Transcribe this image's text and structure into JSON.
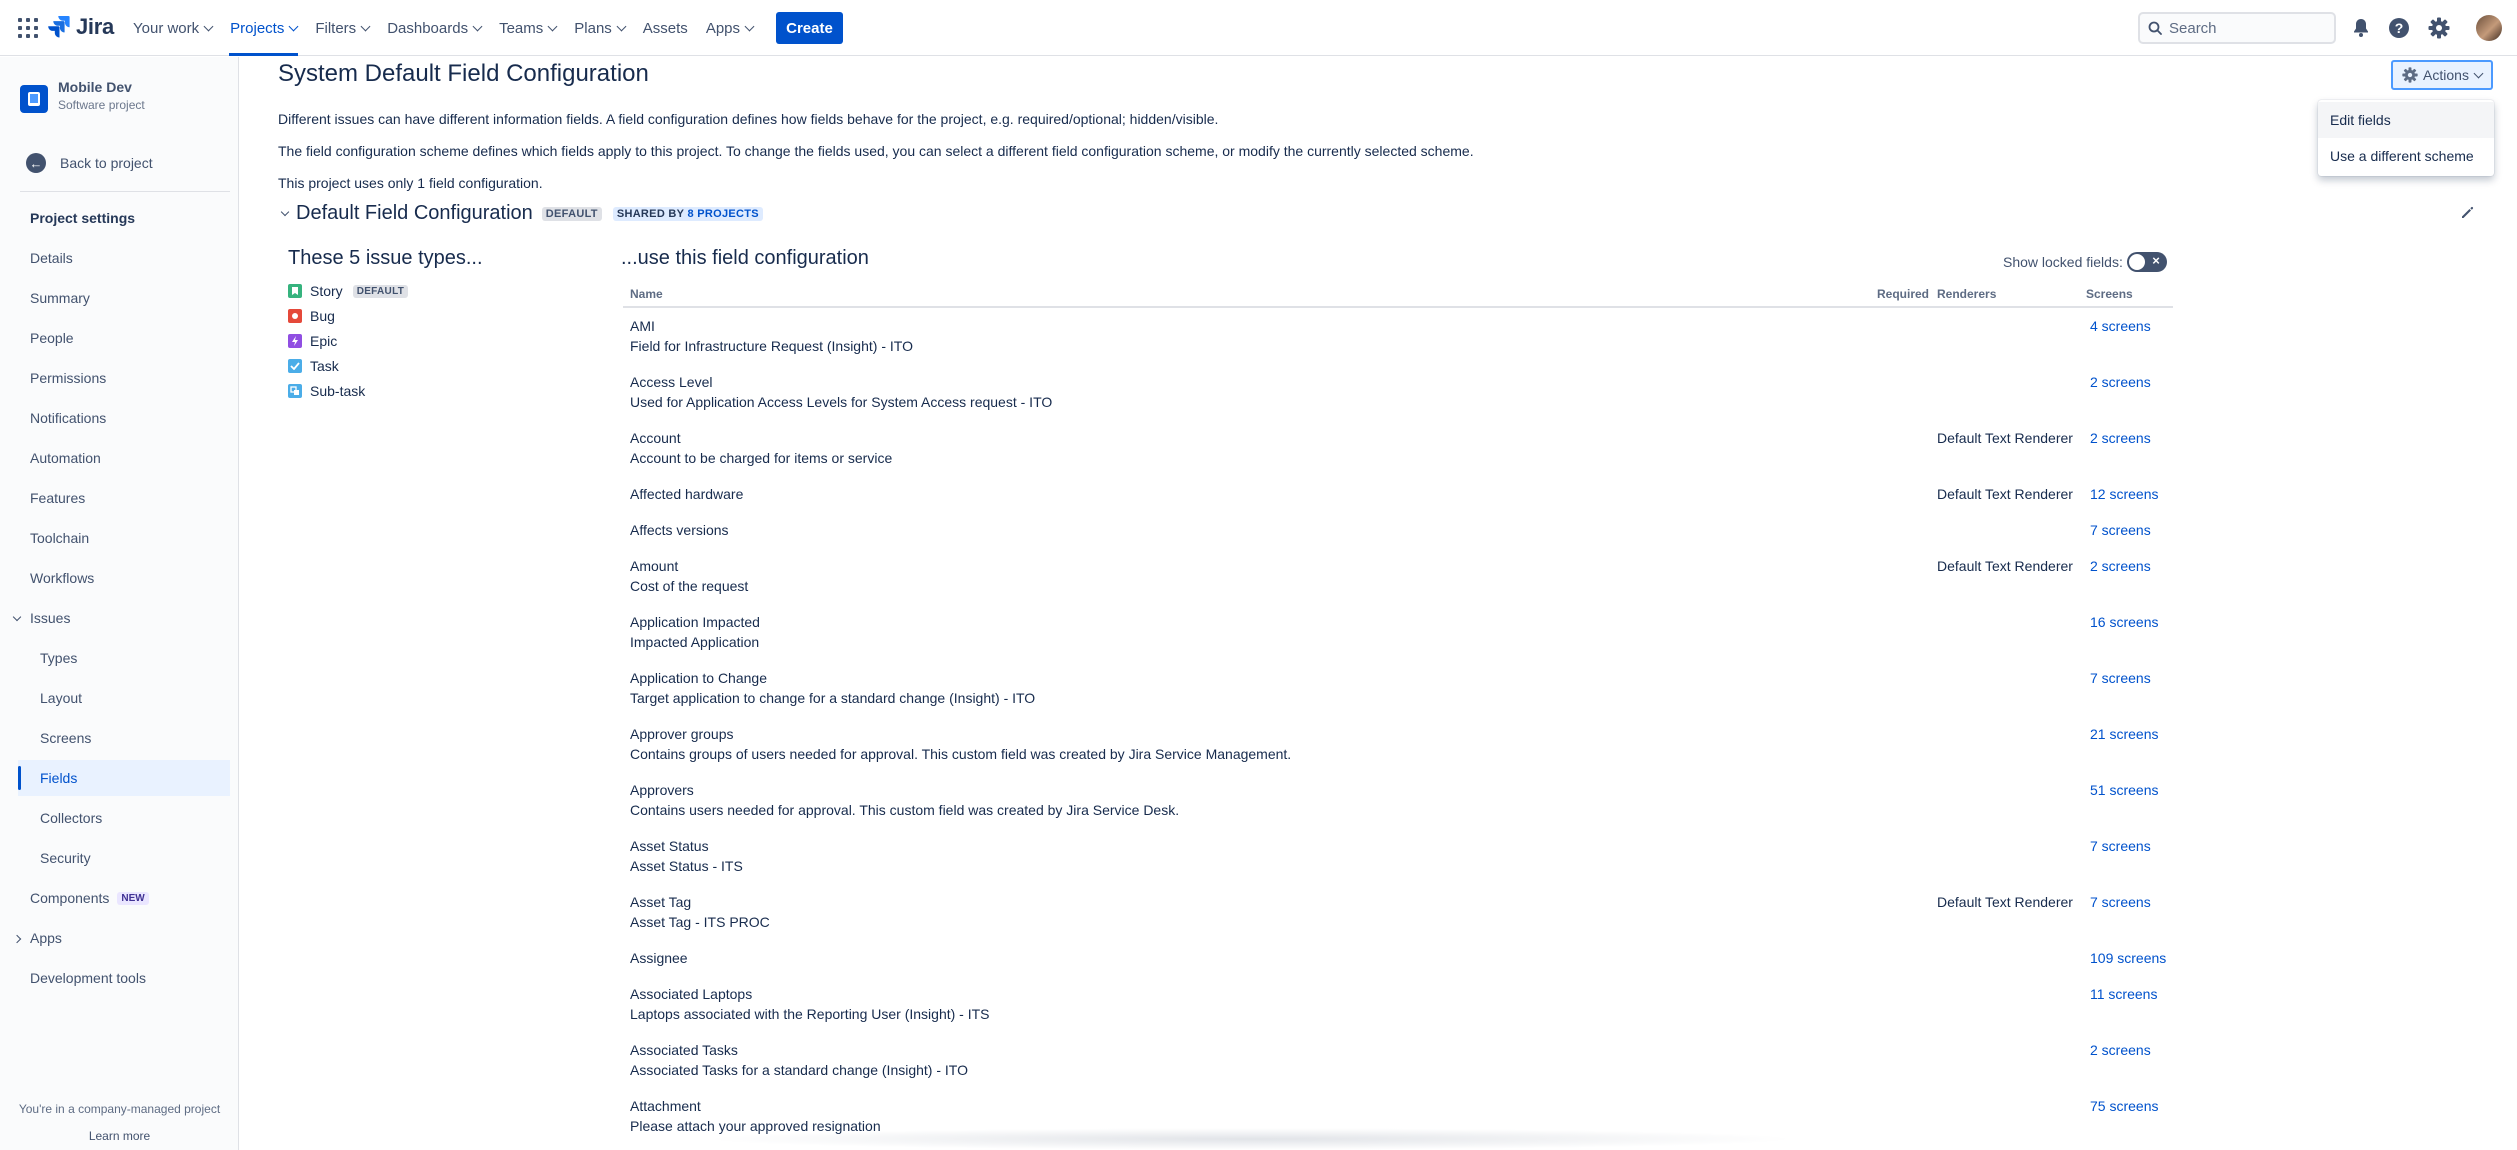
{
  "topnav": {
    "logo_text": "Jira",
    "items": [
      {
        "label": "Your work"
      },
      {
        "label": "Projects"
      },
      {
        "label": "Filters"
      },
      {
        "label": "Dashboards"
      },
      {
        "label": "Teams"
      },
      {
        "label": "Plans"
      },
      {
        "label": "Assets"
      },
      {
        "label": "Apps"
      }
    ],
    "create_label": "Create",
    "search_placeholder": "Search",
    "accent": "#0052cc"
  },
  "sidebar": {
    "project_name": "Mobile Dev",
    "project_type": "Software project",
    "back_label": "Back to project",
    "settings_label": "Project settings",
    "items": [
      {
        "label": "Details"
      },
      {
        "label": "Summary"
      },
      {
        "label": "People"
      },
      {
        "label": "Permissions"
      },
      {
        "label": "Notifications"
      },
      {
        "label": "Automation"
      },
      {
        "label": "Features"
      },
      {
        "label": "Toolchain"
      },
      {
        "label": "Workflows"
      },
      {
        "label": "Issues"
      },
      {
        "label": "Types"
      },
      {
        "label": "Layout"
      },
      {
        "label": "Screens"
      },
      {
        "label": "Fields"
      },
      {
        "label": "Collectors"
      },
      {
        "label": "Security"
      },
      {
        "label": "Components"
      },
      {
        "label": "Apps"
      },
      {
        "label": "Development tools"
      }
    ],
    "new_badge": "NEW",
    "footer_text": "You're in a company-managed project",
    "learn_more": "Learn more"
  },
  "main": {
    "title": "System Default Field Configuration",
    "actions_label": "Actions",
    "actions_menu": [
      {
        "label": "Edit fields"
      },
      {
        "label": "Use a different scheme"
      }
    ],
    "paragraphs": [
      "Different issues can have different information fields. A field configuration defines how fields behave for the project, e.g. required/optional; hidden/visible.",
      "The field configuration scheme defines which fields apply to this project. To change the fields used, you can select a different field configuration scheme, or modify the currently selected scheme.",
      "This project uses only 1 field configuration."
    ],
    "config_name": "Default Field Configuration",
    "default_lozenge": "DEFAULT",
    "shared_by_prefix": "SHARED BY",
    "shared_by_link": "8 PROJECTS",
    "issue_types_title": "These 5 issue types...",
    "issue_types": [
      {
        "label": "Story",
        "color": "#36b37e"
      },
      {
        "label": "Bug",
        "color": "#e5493a"
      },
      {
        "label": "Epic",
        "color": "#904ee2"
      },
      {
        "label": "Task",
        "color": "#4bade8"
      },
      {
        "label": "Sub-task",
        "color": "#4bade8"
      }
    ],
    "fields_title": "...use this field configuration",
    "show_locked_label": "Show locked fields:",
    "columns": {
      "name": "Name",
      "required": "Required",
      "renderers": "Renderers",
      "screens": "Screens"
    },
    "fields": [
      {
        "name": "AMI",
        "desc": "Field for Infrastructure Request (Insight) - ITO",
        "renderer": "",
        "screens": "4 screens"
      },
      {
        "name": "Access Level",
        "desc": "Used for Application Access Levels for System Access request - ITO",
        "renderer": "",
        "screens": "2 screens"
      },
      {
        "name": "Account",
        "desc": "Account to be charged for items or service",
        "renderer": "Default Text Renderer",
        "screens": "2 screens"
      },
      {
        "name": "Affected hardware",
        "desc": "",
        "renderer": "Default Text Renderer",
        "screens": "12 screens"
      },
      {
        "name": "Affects versions",
        "desc": "",
        "renderer": "",
        "screens": "7 screens"
      },
      {
        "name": "Amount",
        "desc": "Cost of the request",
        "renderer": "Default Text Renderer",
        "screens": "2 screens"
      },
      {
        "name": "Application Impacted",
        "desc": "Impacted Application",
        "renderer": "",
        "screens": "16 screens"
      },
      {
        "name": "Application to Change",
        "desc": "Target application to change for a standard change (Insight) - ITO",
        "renderer": "",
        "screens": "7 screens"
      },
      {
        "name": "Approver groups",
        "desc": "Contains groups of users needed for approval. This custom field was created by Jira Service Management.",
        "renderer": "",
        "screens": "21 screens"
      },
      {
        "name": "Approvers",
        "desc": "Contains users needed for approval. This custom field was created by Jira Service Desk.",
        "renderer": "",
        "screens": "51 screens"
      },
      {
        "name": "Asset Status",
        "desc": "Asset Status - ITS",
        "renderer": "",
        "screens": "7 screens"
      },
      {
        "name": "Asset Tag",
        "desc": "Asset Tag - ITS PROC",
        "renderer": "Default Text Renderer",
        "screens": "7 screens"
      },
      {
        "name": "Assignee",
        "desc": "",
        "renderer": "",
        "screens": "109 screens"
      },
      {
        "name": "Associated Laptops",
        "desc": "Laptops associated with the Reporting User (Insight) - ITS",
        "renderer": "",
        "screens": "11 screens"
      },
      {
        "name": "Associated Tasks",
        "desc": "Associated Tasks for a standard change (Insight) - ITO",
        "renderer": "",
        "screens": "2 screens"
      },
      {
        "name": "Attachment",
        "desc": "Please attach your approved resignation",
        "renderer": "",
        "screens": "75 screens"
      }
    ]
  }
}
